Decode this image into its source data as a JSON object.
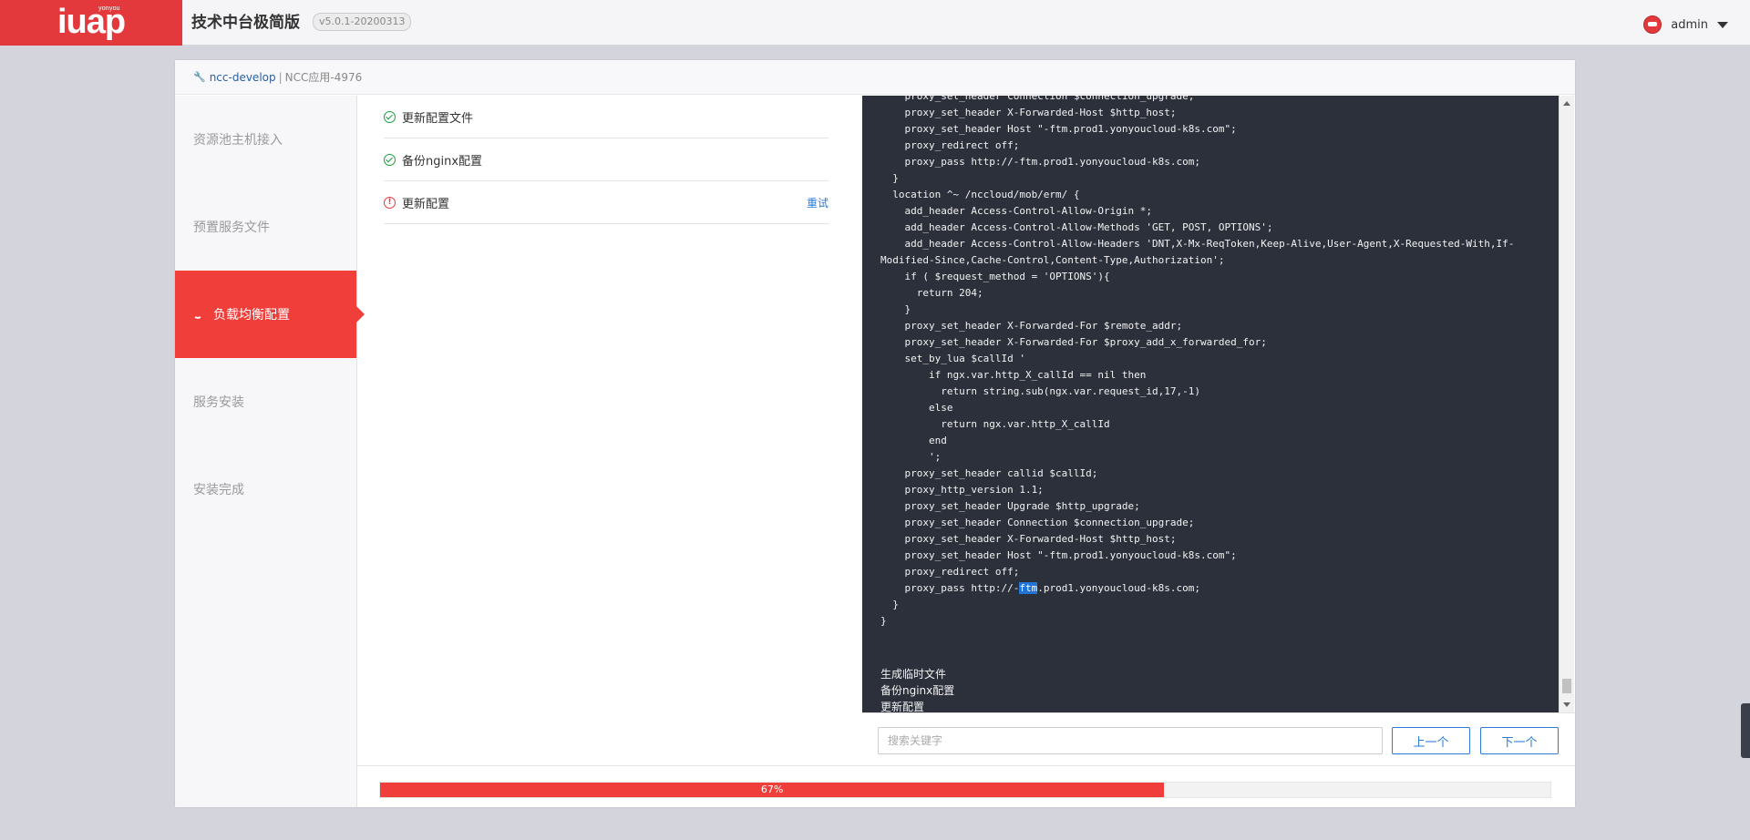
{
  "header": {
    "logo_sup": "yonyou",
    "logo_main": "iuap",
    "app_title": "技术中台极简版",
    "version": "v5.0.1-20200313",
    "user": "admin"
  },
  "breadcrumb": {
    "project": "ncc-develop",
    "separator": "|",
    "app": "NCC应用-4976"
  },
  "sidebar": {
    "steps": [
      {
        "label": "资源池主机接入"
      },
      {
        "label": "预置服务文件"
      },
      {
        "label": "负载均衡配置",
        "active": true
      },
      {
        "label": "服务安装"
      },
      {
        "label": "安装完成"
      }
    ]
  },
  "tasks": [
    {
      "label": "更新配置文件",
      "status": "success"
    },
    {
      "label": "备份nginx配置",
      "status": "success"
    },
    {
      "label": "更新配置",
      "status": "error",
      "action": "重试"
    }
  ],
  "log": {
    "lines_before_highlight": "    proxy_set_header Connection $connection_upgrade;\n    proxy_set_header X-Forwarded-Host $http_host;\n    proxy_set_header Host \"-ftm.prod1.yonyoucloud-k8s.com\";\n    proxy_redirect off;\n    proxy_pass http://-ftm.prod1.yonyoucloud-k8s.com;\n  }\n  location ^~ /nccloud/mob/erm/ {\n    add_header Access-Control-Allow-Origin *;\n    add_header Access-Control-Allow-Methods 'GET, POST, OPTIONS';\n    add_header Access-Control-Allow-Headers 'DNT,X-Mx-ReqToken,Keep-Alive,User-Agent,X-Requested-With,If-\nModified-Since,Cache-Control,Content-Type,Authorization';\n    if ( $request_method = 'OPTIONS'){\n      return 204;\n    }\n    proxy_set_header X-Forwarded-For $remote_addr;\n    proxy_set_header X-Forwarded-For $proxy_add_x_forwarded_for;\n    set_by_lua $callId '\n        if ngx.var.http_X_callId == nil then\n          return string.sub(ngx.var.request_id,17,-1)\n        else\n          return ngx.var.http_X_callId\n        end\n        ';\n    proxy_set_header callid $callId;\n    proxy_http_version 1.1;\n    proxy_set_header Upgrade $http_upgrade;\n    proxy_set_header Connection $connection_upgrade;\n    proxy_set_header X-Forwarded-Host $http_host;\n    proxy_set_header Host \"-ftm.prod1.yonyoucloud-k8s.com\";\n    proxy_redirect off;\n    proxy_pass http://-",
    "highlight": "ftm",
    "lines_after_highlight": ".prod1.yonyoucloud-k8s.com;\n  }\n}",
    "tail": [
      "生成临时文件",
      "备份nginx配置",
      "更新配置"
    ]
  },
  "search": {
    "placeholder": "搜索关键字",
    "prev_label": "上一个",
    "next_label": "下一个"
  },
  "progress": {
    "value": 0.67,
    "label": "67%"
  },
  "colors": {
    "brand": "#e4393c",
    "accent": "#2a7ad6",
    "success": "#1e9b3c"
  }
}
